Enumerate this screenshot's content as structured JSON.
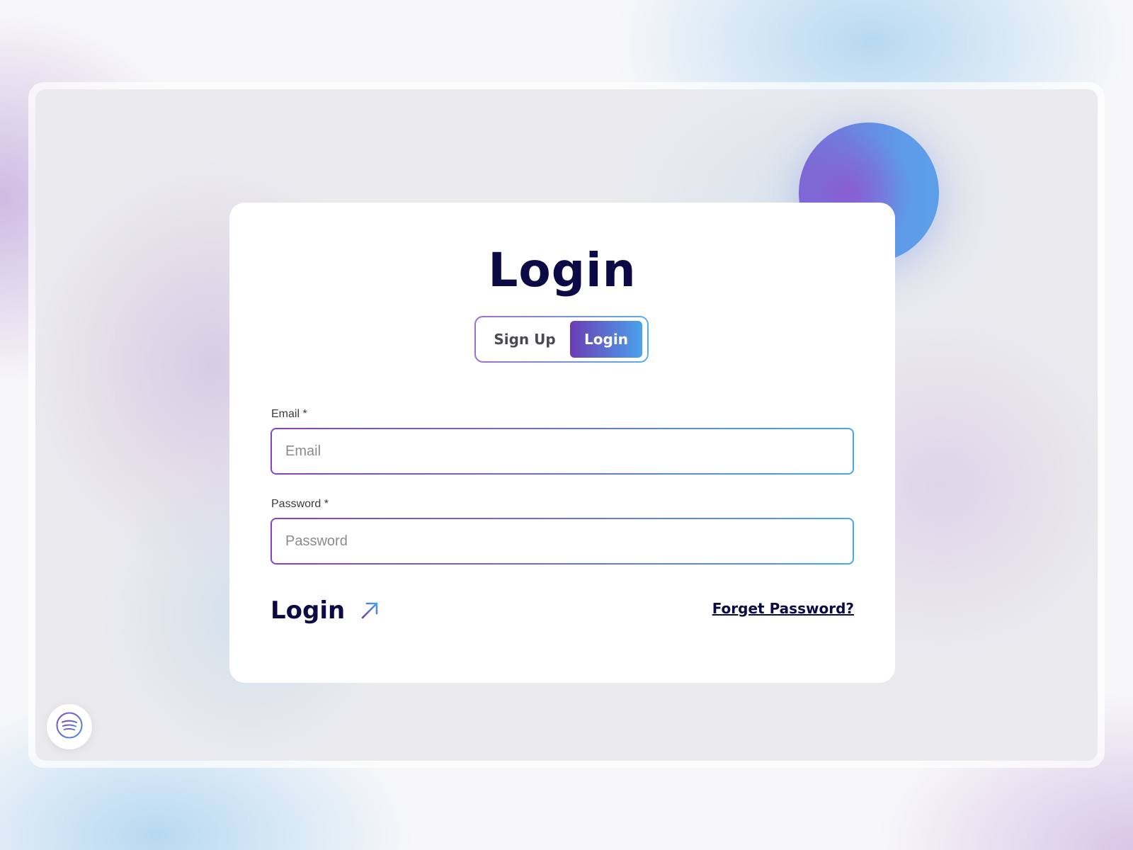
{
  "card": {
    "title": "Login"
  },
  "toggle": {
    "signup_label": "Sign Up",
    "login_label": "Login",
    "active": "Login"
  },
  "form": {
    "email": {
      "label": "Email *",
      "placeholder": "Email",
      "value": ""
    },
    "password": {
      "label": "Password *",
      "placeholder": "Password",
      "value": ""
    },
    "submit_label": "Login",
    "submit_icon": "arrow-up-right-icon",
    "forgot_label": "Forget Password?"
  },
  "widgets": {
    "spotify_icon": "spotify-icon"
  },
  "colors": {
    "title": "#0b0a45",
    "gradient_start": "#6b3cb4",
    "gradient_end": "#4aa3ec",
    "card_background": "#ffffff"
  }
}
